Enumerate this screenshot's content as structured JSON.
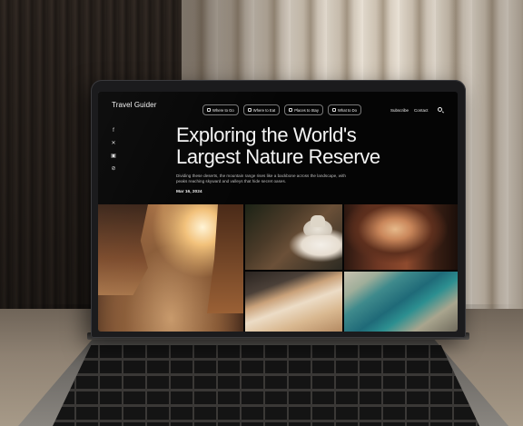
{
  "site": {
    "brand": "Travel Guider",
    "nav_pills": [
      {
        "label": "Where to Go",
        "icon": "compass-icon"
      },
      {
        "label": "Where to Eat",
        "icon": "fork-icon"
      },
      {
        "label": "Places to Stay",
        "icon": "bed-icon"
      },
      {
        "label": "What to Do",
        "icon": "activity-icon"
      }
    ],
    "nav_links": {
      "subscribe": "Subscribe",
      "contact": "Contact"
    },
    "social_icons": [
      "facebook-icon",
      "x-icon",
      "linkedin-icon",
      "link-icon"
    ],
    "article": {
      "title_line1": "Exploring the World's",
      "title_line2": "Largest Nature Reserve",
      "description": "Dividing these deserts, the mountain range rises like a backbone across the landscape, with peaks reaching skyward and valleys that hide secret oases.",
      "date": "Mar 16, 2024"
    }
  }
}
